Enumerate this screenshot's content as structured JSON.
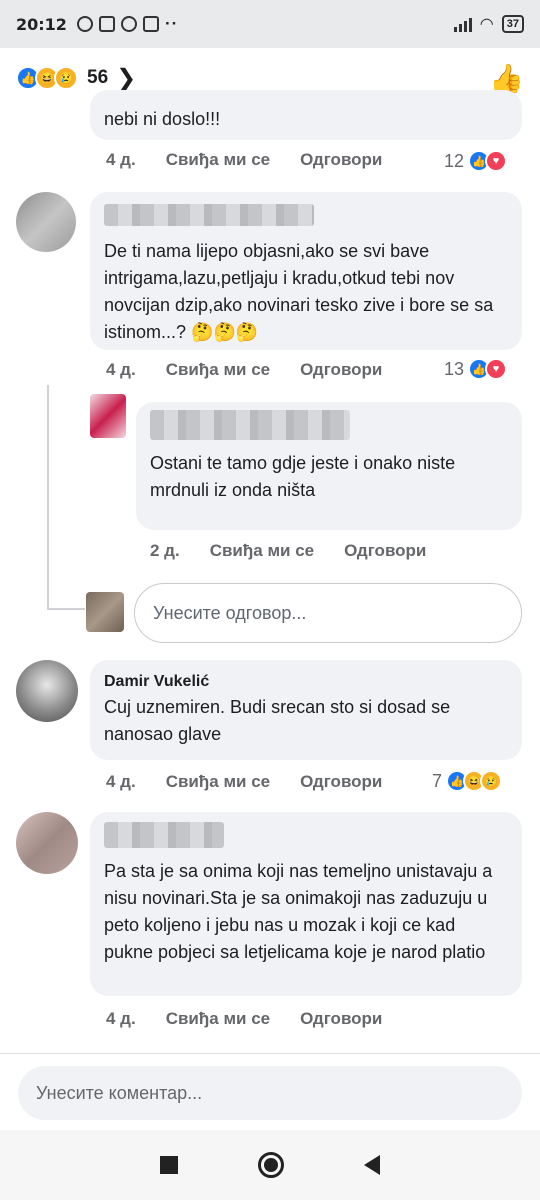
{
  "status_bar": {
    "time": "20:12",
    "battery": "37"
  },
  "header": {
    "reaction_count": "56"
  },
  "comments": [
    {
      "text_tail": "nebi ni doslo!!!",
      "age": "4 д.",
      "like": "Свиђа ми се",
      "reply": "Одговори",
      "reactions": "12"
    },
    {
      "text": "De ti nama lijepo objasni,ako se svi bave intrigama,lazu,petljaju i kradu,otkud tebi nov novcijan dzip,ako novinari tesko zive i bore se sa istinom...? 🤔🤔🤔",
      "age": "4 д.",
      "like": "Свиђа ми се",
      "reply": "Одговори",
      "reactions": "13"
    },
    {
      "text": "Ostani te tamo gdje jeste i onako niste mrdnuli iz onda ništa",
      "age": "2 д.",
      "like": "Свиђа ми се",
      "reply": "Одговори"
    },
    {
      "author": "Damir Vukelić",
      "text": "Cuj uznemiren. Budi srecan sto si dosad se nanosao glave",
      "age": "4 д.",
      "like": "Свиђа ми се",
      "reply": "Одговори",
      "reactions": "7"
    },
    {
      "text": "Pa sta je sa onima koji nas temeljno unistavaju a nisu novinari.Sta je sa onimakoji nas zaduzuju u peto koljeno i jebu nas u mozak i koji ce kad pukne pobjeci sa letjelicama koje je narod platio",
      "age": "4 д.",
      "like": "Свиђа ми се",
      "reply": "Одговори"
    }
  ],
  "reply_input": {
    "placeholder": "Унесите одговор..."
  },
  "composer": {
    "placeholder": "Унесите коментар..."
  }
}
